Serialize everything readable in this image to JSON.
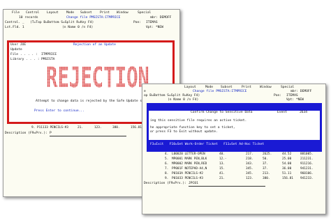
{
  "window1": {
    "menu": [
      "File",
      "Control",
      "Layout",
      "Mode",
      "Subset",
      "Print",
      "Window",
      "Special"
    ],
    "records": "10 records",
    "change_file": "Change file PMSISTA:ITMPRICE",
    "mbr": "mbr: DEMOFF",
    "control_label": "Control. _",
    "control_help": "(T=Top B=Bottom S=Split R=Key F4)",
    "pan_label": "Pan:",
    "pan_value": "ITEMAS",
    "lst_label": "Lst.Fld. 1",
    "name_hint": "(n Name 0 /n F4)",
    "vpt": "Vpt: *NEW",
    "rejection": {
      "user": "User JOE",
      "title": "Rejection of an Update",
      "update": "Update",
      "file_label": "File . . . . :",
      "file_value": "ITMPRICE",
      "library_label": "Library . . . :",
      "library_value": "PMSISTA",
      "banner": "REJECTION",
      "attempt": "Attempt to change data is rejected by the Safe Update system.",
      "press_enter": "Press Enter to continue..."
    },
    "bottom_row": {
      "num": "9.",
      "item": "P11133 PENCILS-#3",
      "c1": "21.",
      "c2": "123.",
      "c3": "380.",
      "c4": "156.81",
      "c5": "941233."
    },
    "description_label": "Description (F9=Prv.):",
    "description_value": "P"
  },
  "window2": {
    "menu": [
      "Layout",
      "Mode",
      "Subset",
      "Print",
      "Window",
      "Special"
    ],
    "first_char": "e",
    "change_file": "Change file PMSISTA:ITMPRICE",
    "mbr": "mbr: DEMOFF",
    "control_help": "op B=Bottom S=Split R=Key F4)",
    "pan_label": "Pan:",
    "pan_value": "ITEMAS",
    "name_hint": "(n Name 0 /n F4)",
    "vpt": "Vpt: *NEW",
    "confirm": {
      "title": "Confirm Change to Sensitive Data",
      "event_label": "Event",
      "event_value": "2634",
      "line1": "ing this sensitive file requires an active ticket.",
      "line2": "he appropriate function key to set a ticket,",
      "line3": "or press F3 to Exit without update.",
      "fkeys": "F3=Exit   F10=Set Work-Order Ticket   F11=Set Ad-Hoc Ticket"
    },
    "rows": [
      {
        "num": "4.",
        "item": "L00020 LETTER-OPEN",
        "c1": "40.",
        "c2": "217.",
        "c3": "2625.",
        "c4": "44.52",
        "c5": "881005."
      },
      {
        "num": "5.",
        "item": "MP0001 MARK PEN,BLK",
        "c1": "12.-",
        "c2": "218.",
        "c3": "50.",
        "c4": "25.00",
        "c5": "211231."
      },
      {
        "num": "6.",
        "item": "MP0002 MARK PEN,RED",
        "c1": "13.",
        "c2": "343.",
        "c3": "37.",
        "c4": "54.00",
        "c5": "911216."
      },
      {
        "num": "7.",
        "item": "PP001F NOTEPAD-A4,N",
        "c1": "15.",
        "c2": "345.",
        "c3": "37.",
        "c4": "36.00",
        "c5": "941231."
      },
      {
        "num": "8.",
        "item": "P0103A PENCILS-#2",
        "c1": "41.",
        "c2": "345.",
        "c3": "213.",
        "c4": "51.11",
        "c5": "960106."
      },
      {
        "num": "9.",
        "item": "P01033 PENCILS-#3",
        "c1": "21.",
        "c2": "123.",
        "c3": "380.",
        "c4": "156.81",
        "c5": "941233."
      }
    ],
    "description_label": "Description (F9=Prv.):",
    "description_value": "JPC01"
  },
  "colors": {
    "rejection_border": "#d41a1a",
    "confirm_border": "#1a1ad4",
    "header_blue": "#1226c4"
  }
}
